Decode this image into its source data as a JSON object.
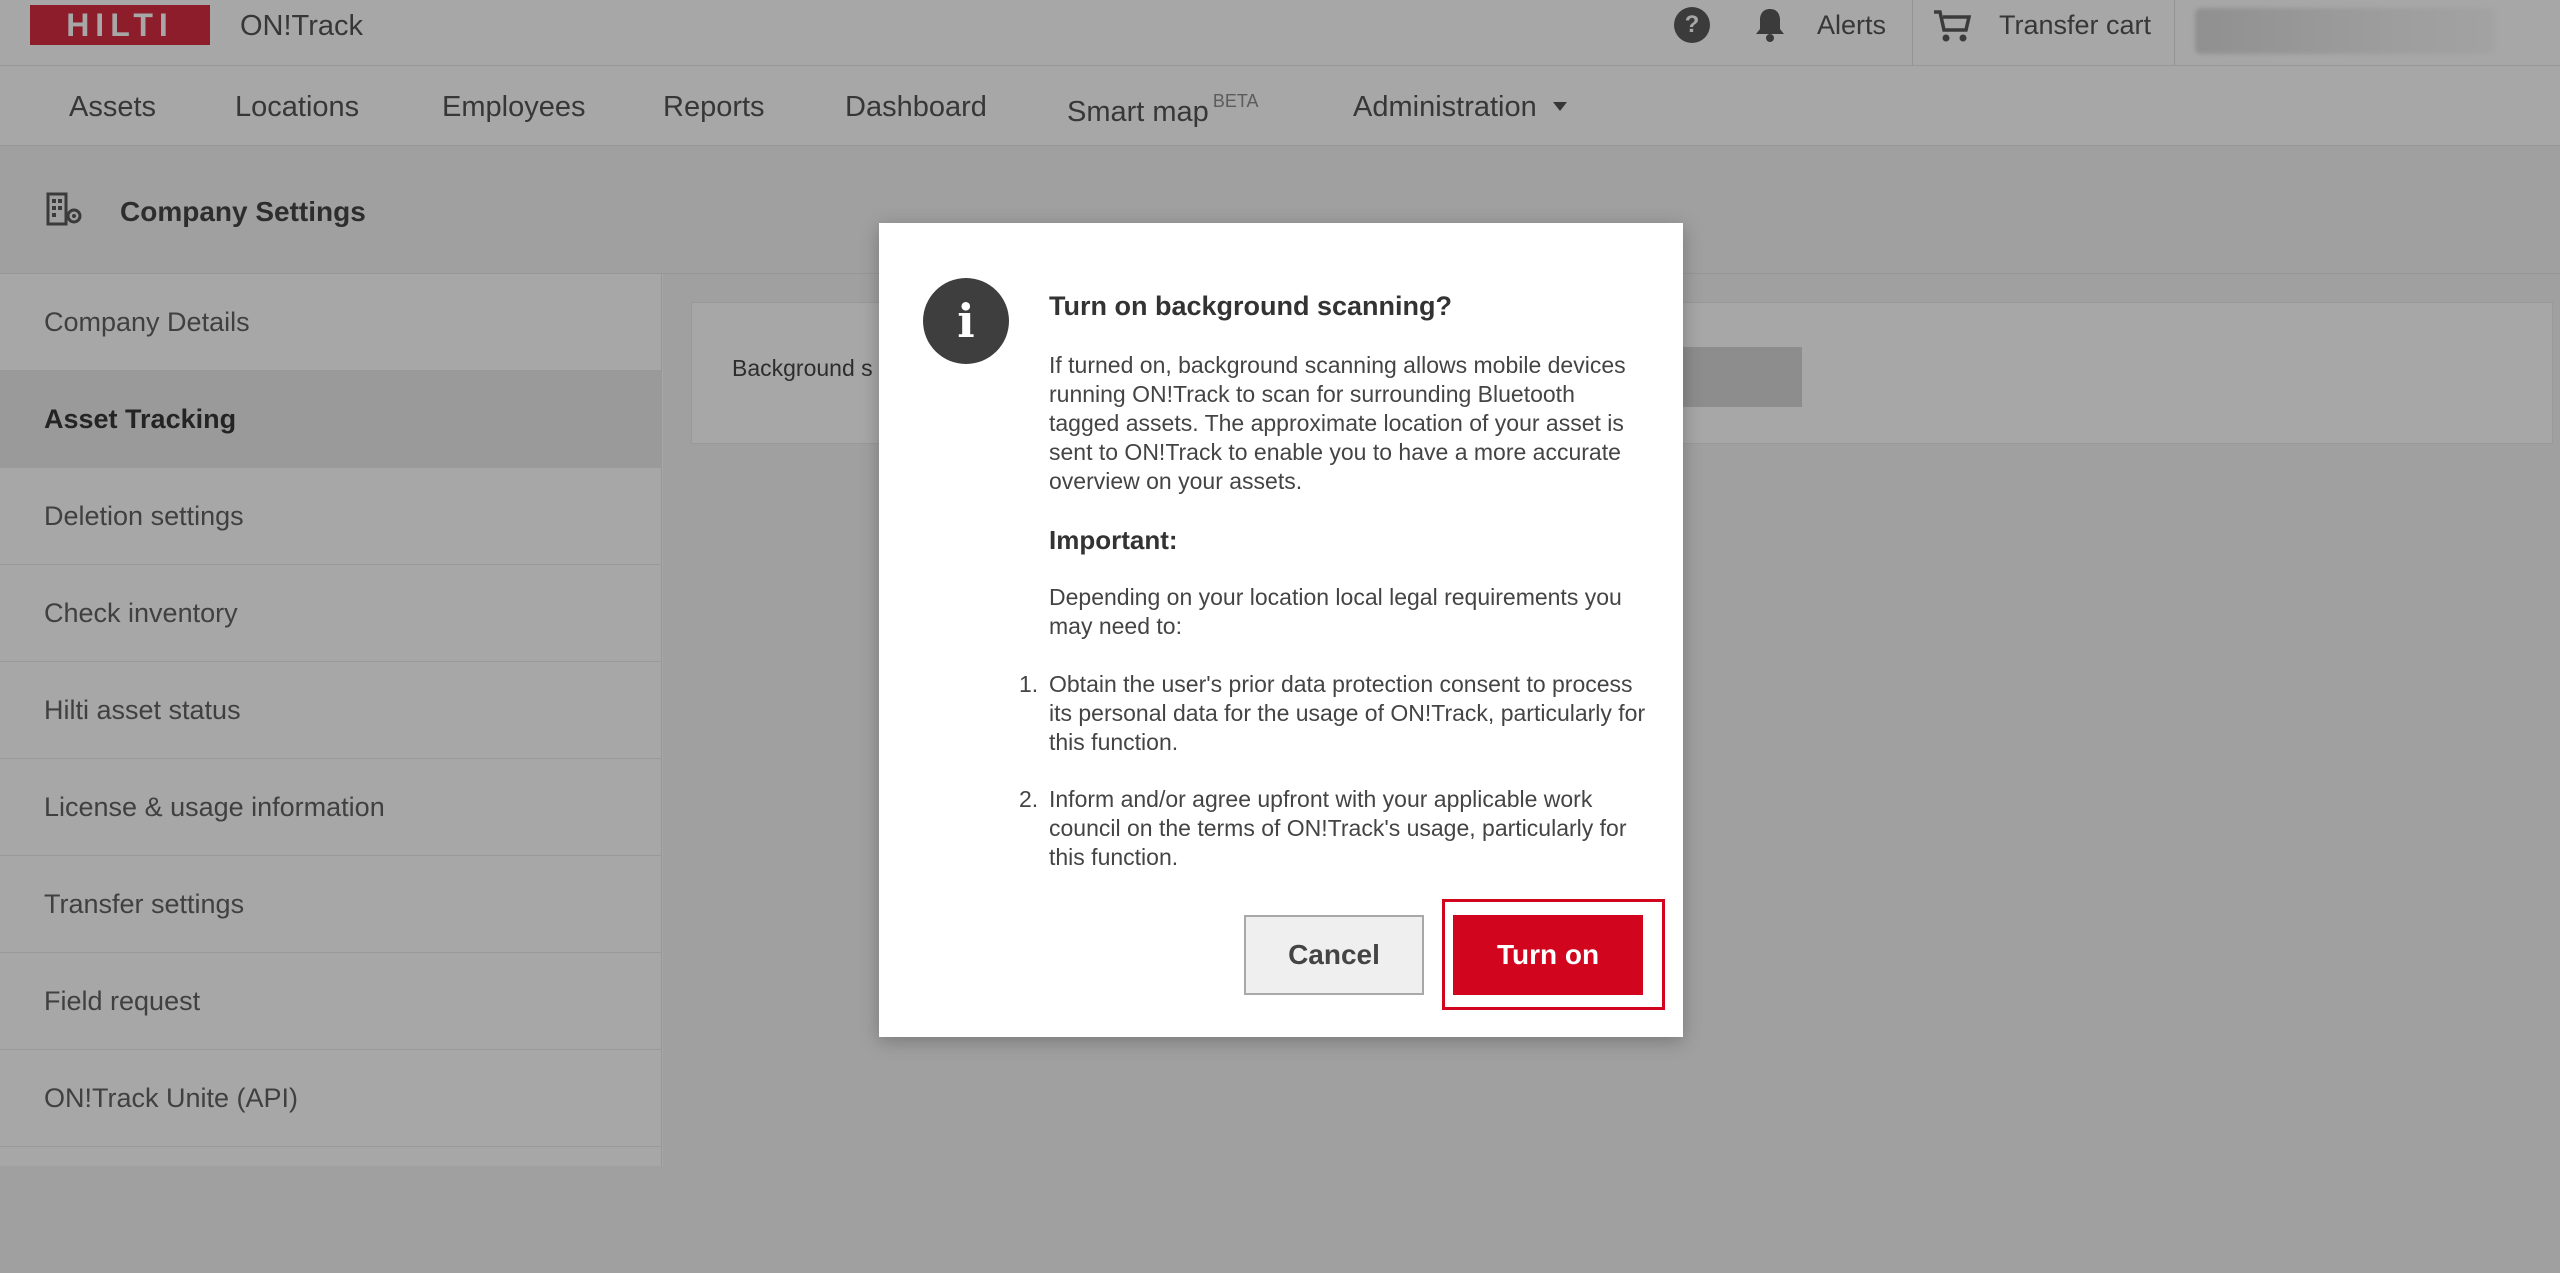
{
  "header": {
    "logo_text": "HILTI",
    "app_name": "ON!Track",
    "help_glyph": "?",
    "alerts_label": "Alerts",
    "transfer_cart_label": "Transfer cart",
    "icons": [
      "help-icon",
      "bell-icon",
      "cart-icon"
    ]
  },
  "nav": {
    "items": [
      "Assets",
      "Locations",
      "Employees",
      "Reports",
      "Dashboard",
      "Smart map",
      "Administration"
    ],
    "smart_map_badge": "BETA"
  },
  "page": {
    "title": "Company Settings",
    "icon": "company-settings-icon"
  },
  "sidebar": {
    "items": [
      {
        "label": "Company Details",
        "active": false
      },
      {
        "label": "Asset Tracking",
        "active": true
      },
      {
        "label": "Deletion settings",
        "active": false
      },
      {
        "label": "Check inventory",
        "active": false
      },
      {
        "label": "Hilti asset status",
        "active": false
      },
      {
        "label": "License & usage information",
        "active": false
      },
      {
        "label": "Transfer settings",
        "active": false
      },
      {
        "label": "Field request",
        "active": false
      },
      {
        "label": "ON!Track Unite (API)",
        "active": false
      }
    ]
  },
  "content": {
    "setting_label_visible": "Background s"
  },
  "modal": {
    "icon": "info-icon",
    "icon_glyph": "i",
    "title": "Turn on background scanning?",
    "body": "If turned on, background scanning allows mobile devices running ON!Track to scan for surrounding Bluetooth tagged assets. The approximate location of your asset is sent to ON!Track to enable you to have a more accurate overview on your assets.",
    "important_heading": "Important:",
    "dependency_text": "Depending on your location local legal requirements you may need to:",
    "list": [
      {
        "num": "1.",
        "text": "Obtain the user's prior data protection consent to process its personal data for the usage of ON!Track, particularly for this function."
      },
      {
        "num": "2.",
        "text": "Inform and/or agree upfront with your applicable work council on the terms of ON!Track's usage, particularly for this function."
      }
    ],
    "cancel_label": "Cancel",
    "confirm_label": "Turn on"
  },
  "colors": {
    "brand_red": "#d2051e",
    "overlay": "rgba(60,60,60,0.45)"
  }
}
